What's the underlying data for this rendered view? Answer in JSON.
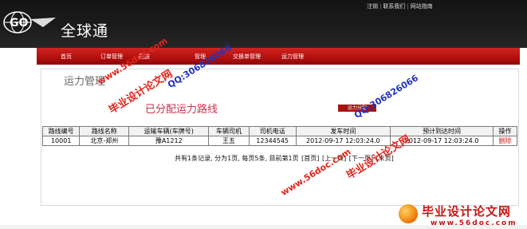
{
  "header": {
    "logo_glyph": "GO",
    "logo_text": "全球通",
    "links": [
      {
        "label": "注销"
      },
      {
        "label": "联系我们"
      },
      {
        "label": "网站指南"
      }
    ]
  },
  "nav": [
    {
      "label": "首页"
    },
    {
      "label": "订单管理"
    },
    {
      "label": "配送"
    },
    {
      "label": "管理"
    },
    {
      "label": "交换单管理"
    },
    {
      "label": "运力管理"
    }
  ],
  "page": {
    "title": "运力管理",
    "section_title": "已分配运力路线",
    "small_button": "运力分配"
  },
  "table": {
    "columns": [
      "路线编号",
      "路线名称",
      "运输车辆(车牌号)",
      "车辆司机",
      "司机电话",
      "发车时间",
      "预计到达时间",
      "操作"
    ],
    "rows": [
      [
        "10001",
        "北京-郑州",
        "豫A1212",
        "王五",
        "12344545",
        "2012-09-17 12:03:24.0",
        "2012-09-17 12:03:24.0",
        "删除"
      ]
    ]
  },
  "pager": {
    "summary": "共有1条记录, 分为1页, 每页5条, 目前第1页",
    "links": [
      "[首页]",
      "[上一页]",
      "[下一页]",
      "[末页]"
    ]
  },
  "watermarks": {
    "site_url": "www.56doc.com",
    "brand": "毕业设计论文网",
    "qq": "QQ:306826066",
    "bottom_brand": "毕业设计论文网",
    "bottom_url": "www.56doc.com"
  }
}
